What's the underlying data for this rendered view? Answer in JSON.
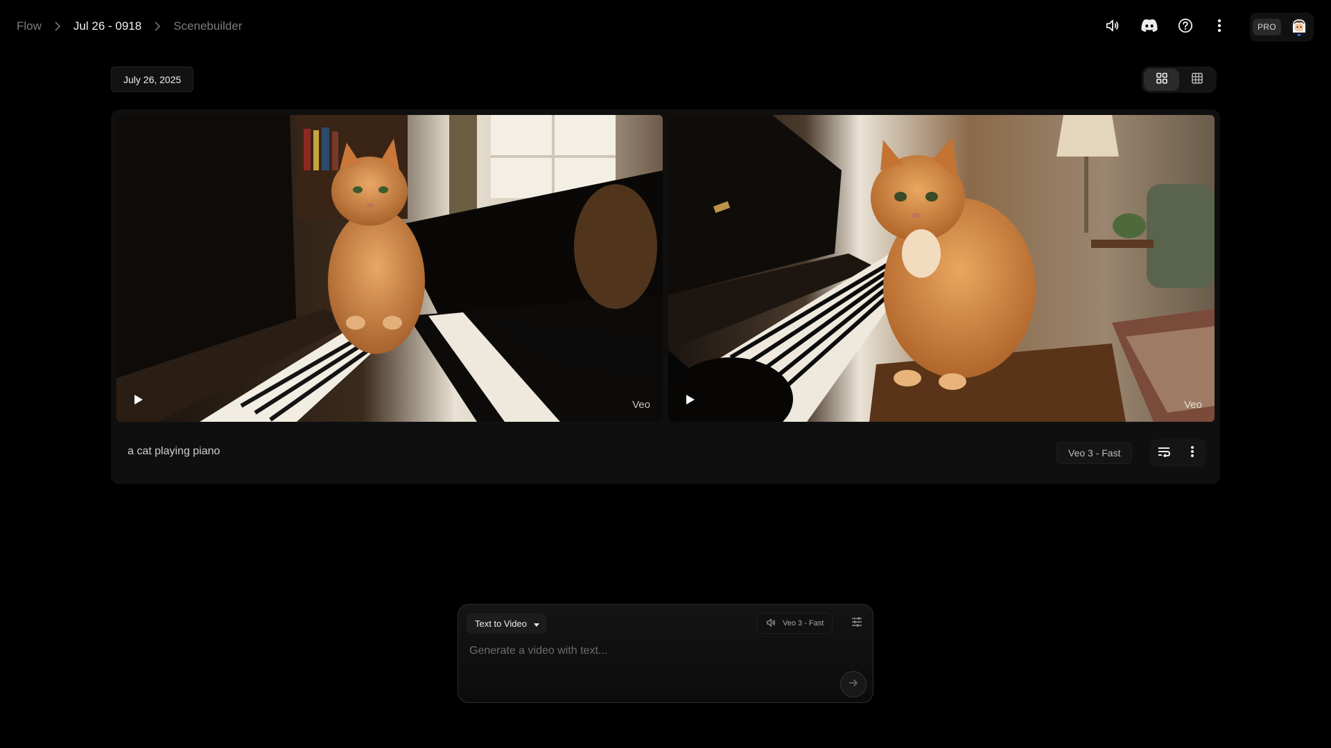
{
  "breadcrumb": {
    "items": [
      {
        "label": "Flow"
      },
      {
        "label": "Jul 26 - 0918"
      },
      {
        "label": "Scenebuilder"
      }
    ]
  },
  "header": {
    "pro_badge": "PRO",
    "icons": [
      "volume-icon",
      "discord-icon",
      "help-icon",
      "more-vert-icon"
    ]
  },
  "date_chip": "July 26, 2025",
  "view_toggle": {
    "options": [
      "grid-view",
      "tile-view"
    ],
    "active": "grid-view"
  },
  "generation": {
    "prompt": "a cat playing piano",
    "model": "Veo 3 - Fast",
    "videos": [
      {
        "watermark": "Veo"
      },
      {
        "watermark": "Veo"
      }
    ]
  },
  "composer": {
    "mode": "Text to Video",
    "model": "Veo 3 - Fast",
    "placeholder": "Generate a video with text..."
  },
  "colors": {
    "background": "#000000",
    "card": "#0f0f0f",
    "text_primary": "#f0f0f0",
    "text_muted": "#7d7d7d"
  }
}
